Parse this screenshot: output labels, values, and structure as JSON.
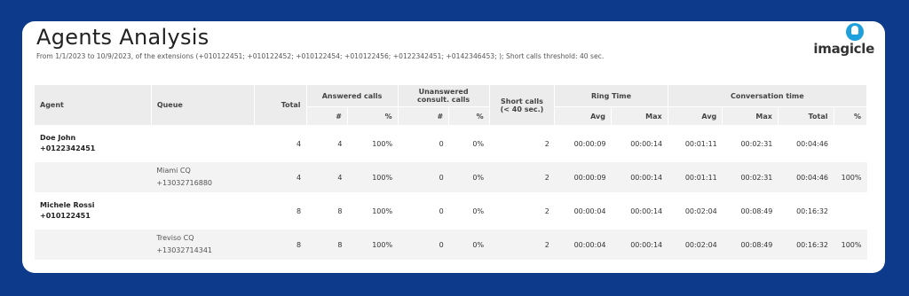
{
  "report": {
    "title": "Agents Analysis",
    "subtitle": "From 1/1/2023 to 10/9/2023, of the extensions (+010122451; +010122452; +010122454; +010122456; +0122342451; +0142346453; ); Short calls threshold: 40 sec.",
    "logo_text": "imagicle"
  },
  "table": {
    "headers": {
      "agent": "Agent",
      "queue": "Queue",
      "total": "Total",
      "answered": "Answered calls",
      "unanswered": "Unanswered consult. calls",
      "short": "Short calls (< 40 sec.)",
      "ring": "Ring Time",
      "conversation": "Conversation time"
    },
    "subheaders": {
      "ans_count": "#",
      "ans_pct": "%",
      "unans_count": "#",
      "unans_pct": "%",
      "ring_avg": "Avg",
      "ring_max": "Max",
      "conv_avg": "Avg",
      "conv_max": "Max",
      "conv_total": "Total",
      "conv_pct": "%"
    },
    "rows": [
      {
        "agent_name": "Doe John",
        "agent_ext": "+0122342451",
        "queue_name": "",
        "queue_ext": "",
        "total": "4",
        "ans_count": "4",
        "ans_pct": "100%",
        "unans_count": "0",
        "unans_pct": "0%",
        "short": "2",
        "ring_avg": "00:00:09",
        "ring_max": "00:00:14",
        "conv_avg": "00:01:11",
        "conv_max": "00:02:31",
        "conv_total": "00:04:46",
        "conv_pct": ""
      },
      {
        "agent_name": "",
        "agent_ext": "",
        "queue_name": "Miami CQ",
        "queue_ext": "+13032716880",
        "total": "4",
        "ans_count": "4",
        "ans_pct": "100%",
        "unans_count": "0",
        "unans_pct": "0%",
        "short": "2",
        "ring_avg": "00:00:09",
        "ring_max": "00:00:14",
        "conv_avg": "00:01:11",
        "conv_max": "00:02:31",
        "conv_total": "00:04:46",
        "conv_pct": "100%"
      },
      {
        "agent_name": "Michele Rossi",
        "agent_ext": "+010122451",
        "queue_name": "",
        "queue_ext": "",
        "total": "8",
        "ans_count": "8",
        "ans_pct": "100%",
        "unans_count": "0",
        "unans_pct": "0%",
        "short": "2",
        "ring_avg": "00:00:04",
        "ring_max": "00:00:14",
        "conv_avg": "00:02:04",
        "conv_max": "00:08:49",
        "conv_total": "00:16:32",
        "conv_pct": ""
      },
      {
        "agent_name": "",
        "agent_ext": "",
        "queue_name": "Treviso CQ",
        "queue_ext": "+13032714341",
        "total": "8",
        "ans_count": "8",
        "ans_pct": "100%",
        "unans_count": "0",
        "unans_pct": "0%",
        "short": "2",
        "ring_avg": "00:00:04",
        "ring_max": "00:00:14",
        "conv_avg": "00:02:04",
        "conv_max": "00:08:49",
        "conv_total": "00:16:32",
        "conv_pct": "100%"
      }
    ]
  },
  "colors": {
    "background": "#0d3a8a",
    "logo_accent": "#1ea0dc",
    "header_bg": "#ececec",
    "queue_row_bg": "#f3f3f3"
  }
}
